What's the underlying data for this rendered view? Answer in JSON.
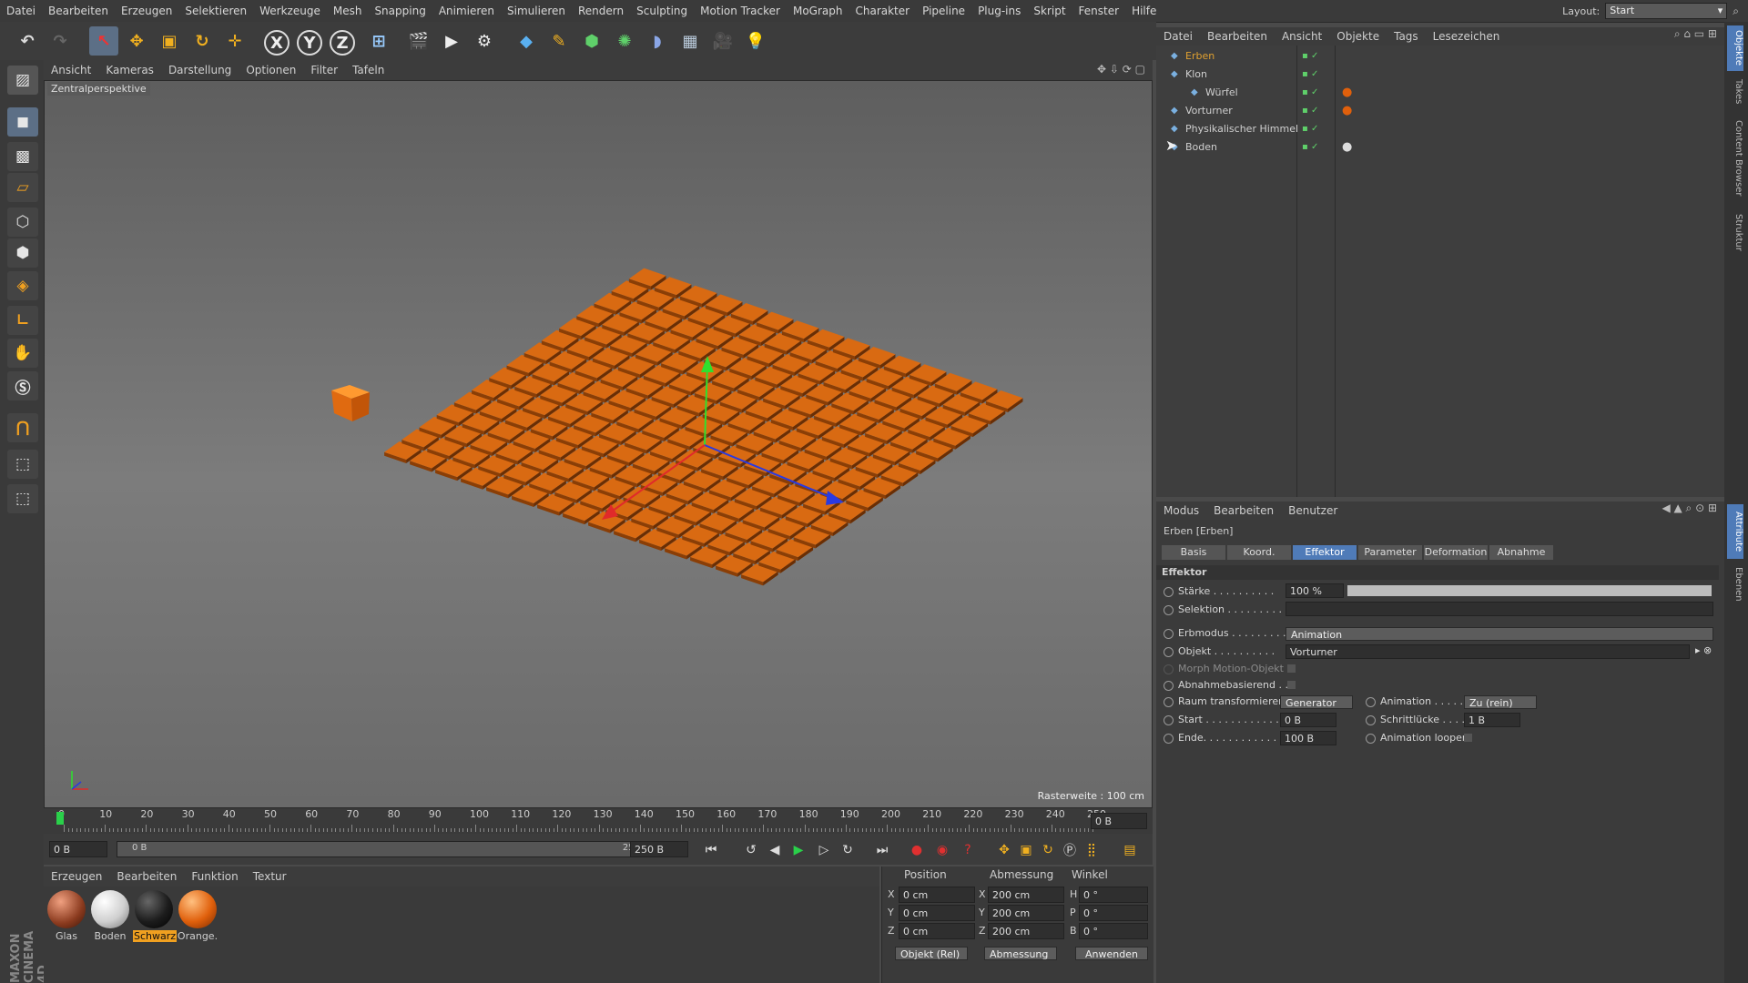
{
  "menu": [
    "Datei",
    "Bearbeiten",
    "Erzeugen",
    "Selektieren",
    "Werkzeuge",
    "Mesh",
    "Snapping",
    "Animieren",
    "Simulieren",
    "Rendern",
    "Sculpting",
    "Motion Tracker",
    "MoGraph",
    "Charakter",
    "Pipeline",
    "Plug-ins",
    "Skript",
    "Fenster",
    "Hilfe"
  ],
  "layout": {
    "label": "Layout:",
    "value": "Start"
  },
  "toolbar": {
    "x": "X",
    "y": "Y",
    "z": "Z"
  },
  "viewport": {
    "menu": [
      "Ansicht",
      "Kameras",
      "Darstellung",
      "Optionen",
      "Filter",
      "Tafeln"
    ],
    "label": "Zentralperspektive",
    "grid": "Rasterweite : 100 cm"
  },
  "timeline": {
    "ticks": [
      "0",
      "10",
      "20",
      "30",
      "40",
      "50",
      "60",
      "70",
      "80",
      "90",
      "100",
      "110",
      "120",
      "130",
      "140",
      "150",
      "160",
      "170",
      "180",
      "190",
      "200",
      "210",
      "220",
      "230",
      "240",
      "250"
    ],
    "current": "0 B",
    "start": "0 B",
    "range_left": "0 B",
    "range_right": "250 B",
    "end": "250 B"
  },
  "materials": {
    "menu": [
      "Erzeugen",
      "Bearbeiten",
      "Funktion",
      "Textur"
    ],
    "items": [
      {
        "name": "Glas",
        "color": "#8a3a1e"
      },
      {
        "name": "Boden",
        "color": "#d8d8d8"
      },
      {
        "name": "Schwarz",
        "color": "#1c1c1c"
      },
      {
        "name": "Orange.",
        "color": "#e0600c"
      }
    ]
  },
  "coords": {
    "headers": [
      "Position",
      "Abmessung",
      "Winkel"
    ],
    "rows": [
      {
        "a": "X",
        "p": "0 cm",
        "b": "X",
        "s": "200 cm",
        "c": "H",
        "r": "0 °"
      },
      {
        "a": "Y",
        "p": "0 cm",
        "b": "Y",
        "s": "200 cm",
        "c": "P",
        "r": "0 °"
      },
      {
        "a": "Z",
        "p": "0 cm",
        "b": "Z",
        "s": "200 cm",
        "c": "B",
        "r": "0 °"
      }
    ],
    "mode": "Objekt (Rel)",
    "size_mode": "Abmessung",
    "apply": "Anwenden"
  },
  "objects": {
    "menu": [
      "Datei",
      "Bearbeiten",
      "Ansicht",
      "Objekte",
      "Tags",
      "Lesezeichen"
    ],
    "items": [
      {
        "name": "Erben",
        "color": "#e0a030"
      },
      {
        "name": "Klon",
        "color": "#cfcfcf"
      },
      {
        "name": "Würfel",
        "color": "#cfcfcf"
      },
      {
        "name": "Vorturner",
        "color": "#cfcfcf"
      },
      {
        "name": "Physikalischer Himmel",
        "color": "#cfcfcf"
      },
      {
        "name": "Boden",
        "color": "#cfcfcf"
      }
    ]
  },
  "attributes": {
    "menu": [
      "Modus",
      "Bearbeiten",
      "Benutzer"
    ],
    "title": "Erben [Erben]",
    "tabs": [
      "Basis",
      "Koord.",
      "Effektor",
      "Parameter",
      "Deformation",
      "Abnahme"
    ],
    "section": "Effektor",
    "staerke_label": "Stärke . . . . . . . . . .",
    "staerke": "100 %",
    "staerke_fraction": 1.0,
    "selektion_label": "Selektion . . . . . . . . .",
    "erbmodus_label": "Erbmodus . . . . . . . . .",
    "erbmodus": "Animation",
    "objekt_label": "Objekt . . . . . . . . . .",
    "objekt": "Vorturner",
    "morph_label": "Morph Motion-Objekt",
    "abnahme_label": "Abnahmebasierend . .",
    "raum_label": "Raum transformieren",
    "raum": "Generator",
    "animation_label": "Animation . . . . . .",
    "animation": "Zu (rein)",
    "start_label": "Start . . . . . . . . . . . .",
    "start": "0 B",
    "schritt_label": "Schrittlücke . . . . .",
    "schritt": "1 B",
    "ende_label": "Ende. . . . . . . . . . . . .",
    "ende": "100 B",
    "loop_label": "Animation loopen"
  },
  "side_tabs": [
    "Objekte",
    "Takes",
    "Content Browser",
    "Struktur",
    "Attribute",
    "Ebenen"
  ],
  "brand": "MAXON CINEMA 4D"
}
